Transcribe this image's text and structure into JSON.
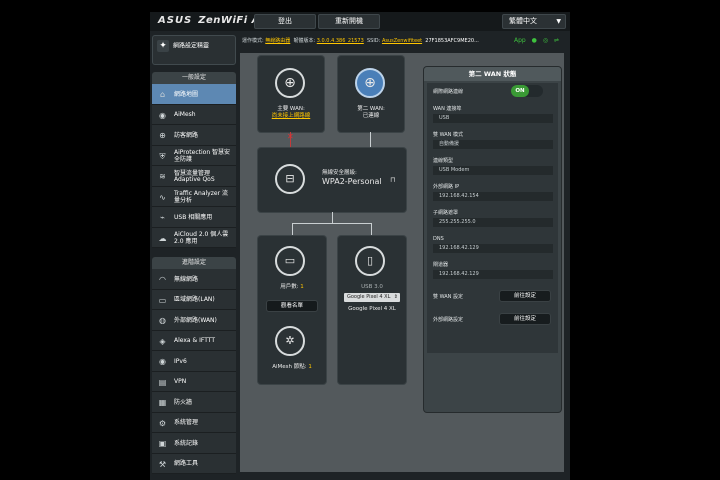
{
  "header": {
    "brand": "ASUS",
    "product": "ZenWiFi AC",
    "logout": "登出",
    "reboot": "重新開機",
    "language": "繁體中文"
  },
  "status": {
    "mode_label": "運作模式:",
    "mode_value": "無線路由器",
    "firmware_label": "韌體版本:",
    "firmware_value": "3.0.0.4.386_21573",
    "ssid_label": "SSID:",
    "ssid_value": "AsusZenwifiteet",
    "ssid2": "27F1853AFC9ME20...",
    "app": "App"
  },
  "sidebar": {
    "quick_setup": "網路設定精靈",
    "general_header": "一般設定",
    "general_items": [
      {
        "label": "網路地圖",
        "icon": "network-map-icon"
      },
      {
        "label": "AiMesh",
        "icon": "aimesh-icon"
      },
      {
        "label": "訪客網路",
        "icon": "guest-network-icon"
      },
      {
        "label": "AiProtection 智慧安全防護",
        "icon": "aiprotection-icon"
      },
      {
        "label": "智慧流量管理 Adaptive QoS",
        "icon": "qos-icon"
      },
      {
        "label": "Traffic Analyzer 流量分析",
        "icon": "traffic-analyzer-icon"
      },
      {
        "label": "USB 相關應用",
        "icon": "usb-icon"
      },
      {
        "label": "AiCloud 2.0 個人雲 2.0 應用",
        "icon": "aicloud-icon"
      }
    ],
    "advanced_header": "進階設定",
    "advanced_items": [
      {
        "label": "無線網路",
        "icon": "wireless-icon"
      },
      {
        "label": "區域網路(LAN)",
        "icon": "lan-icon"
      },
      {
        "label": "外部網路(WAN)",
        "icon": "wan-icon"
      },
      {
        "label": "Alexa & IFTTT",
        "icon": "alexa-icon"
      },
      {
        "label": "IPv6",
        "icon": "ipv6-icon"
      },
      {
        "label": "VPN",
        "icon": "vpn-icon"
      },
      {
        "label": "防火牆",
        "icon": "firewall-icon"
      },
      {
        "label": "系統管理",
        "icon": "administration-icon"
      },
      {
        "label": "系統記錄",
        "icon": "system-log-icon"
      },
      {
        "label": "網路工具",
        "icon": "network-tools-icon"
      }
    ]
  },
  "map": {
    "primary_wan_label": "主要 WAN:",
    "primary_wan_status": "尚未接上網路線",
    "secondary_wan_label": "第二 WAN:",
    "secondary_wan_status": "已連線",
    "security_label": "無線安全層級:",
    "security_value": "WPA2-Personal",
    "clients_label": "用戶數:",
    "clients_count": "1",
    "view_list": "觀看名單",
    "aimesh_label": "AiMesh 節點:",
    "aimesh_count": "1",
    "usb_label": "USB 3.0",
    "usb_device_select": "Google Pixel 4 XL",
    "usb_device_name": "Google Pixel 4 XL"
  },
  "wan_panel": {
    "title": "第二 WAN 狀態",
    "toggle_label": "網際網路連線",
    "toggle_value": "ON",
    "rows": [
      {
        "key": "WAN 連接埠",
        "value": "USB"
      },
      {
        "key": "雙 WAN 模式",
        "value": "自動備援"
      },
      {
        "key": "連線類型",
        "value": "USB Modem"
      },
      {
        "key": "外部網路 IP",
        "value": "192.168.42.154"
      },
      {
        "key": "子網路遮罩",
        "value": "255.255.255.0"
      },
      {
        "key": "DNS",
        "value": "192.168.42.129"
      },
      {
        "key": "閘道器",
        "value": "192.168.42.129"
      }
    ],
    "dual_wan_setting": "雙 WAN 設定",
    "wan_setting": "外部網路設定",
    "goto_label": "前往設定",
    "goto_label2": "前往設定"
  }
}
